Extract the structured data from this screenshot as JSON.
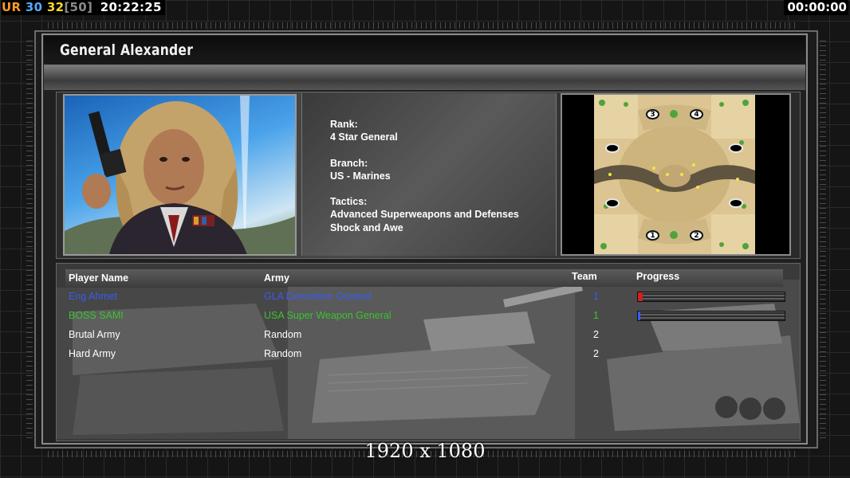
{
  "hud": {
    "ur_label": "UR",
    "val_a": "30",
    "val_b": "32",
    "val_c": "[50]",
    "clock": "20:22:25",
    "timer": "00:00:00"
  },
  "general": {
    "name": "General Alexander",
    "rank_label": "Rank:",
    "rank_value": "4 Star General",
    "branch_label": "Branch:",
    "branch_value": "US - Marines",
    "tactics_label": "Tactics:",
    "tactics_line1": "Advanced Superweapons and Defenses",
    "tactics_line2": "Shock and Awe"
  },
  "map": {
    "markers": [
      "3",
      "4",
      "1",
      "2"
    ]
  },
  "table": {
    "headers": {
      "player": "Player Name",
      "army": "Army",
      "team": "Team",
      "progress": "Progress"
    },
    "rows": [
      {
        "player": "Eng Ahmet",
        "army": "GLA Demolition General",
        "team": "1",
        "color": "#3a5cf0",
        "progress": 0.03,
        "fill_color": "#d02020"
      },
      {
        "player": "BOSS SAMI",
        "army": "USA Super Weapon General",
        "team": "1",
        "color": "#39c42c",
        "progress": 0.01,
        "fill_color": "#3a5cf0"
      },
      {
        "player": "Brutal Army",
        "army": "Random",
        "team": "2",
        "color": "#ffffff"
      },
      {
        "player": "Hard Army",
        "army": "Random",
        "team": "2",
        "color": "#ffffff"
      }
    ]
  },
  "resolution_label": "1920 x 1080"
}
